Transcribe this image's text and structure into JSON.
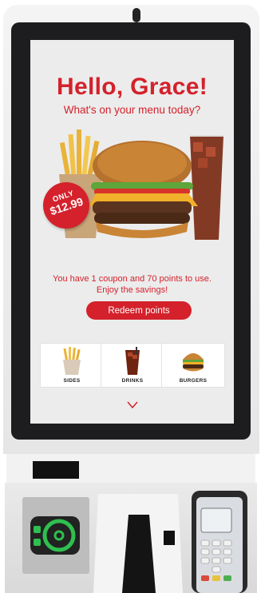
{
  "screen": {
    "greeting": "Hello, Grace!",
    "subtitle": "What's on your menu today?",
    "badge": {
      "label": "ONLY",
      "price": "$12.99"
    },
    "points_message_line1": "You have 1 coupon and 70 points to use.",
    "points_message_line2": "Enjoy the savings!",
    "redeem_label": "Redeem points",
    "categories": [
      {
        "label": "SIDES",
        "icon": "fries-icon"
      },
      {
        "label": "DRINKS",
        "icon": "drink-icon"
      },
      {
        "label": "BURGERS",
        "icon": "burger-icon"
      }
    ],
    "scroll_icon": "chevron-down-icon"
  },
  "colors": {
    "accent": "#d4212b",
    "screen_bg": "#ececec",
    "bezel": "#1d1d1f"
  }
}
